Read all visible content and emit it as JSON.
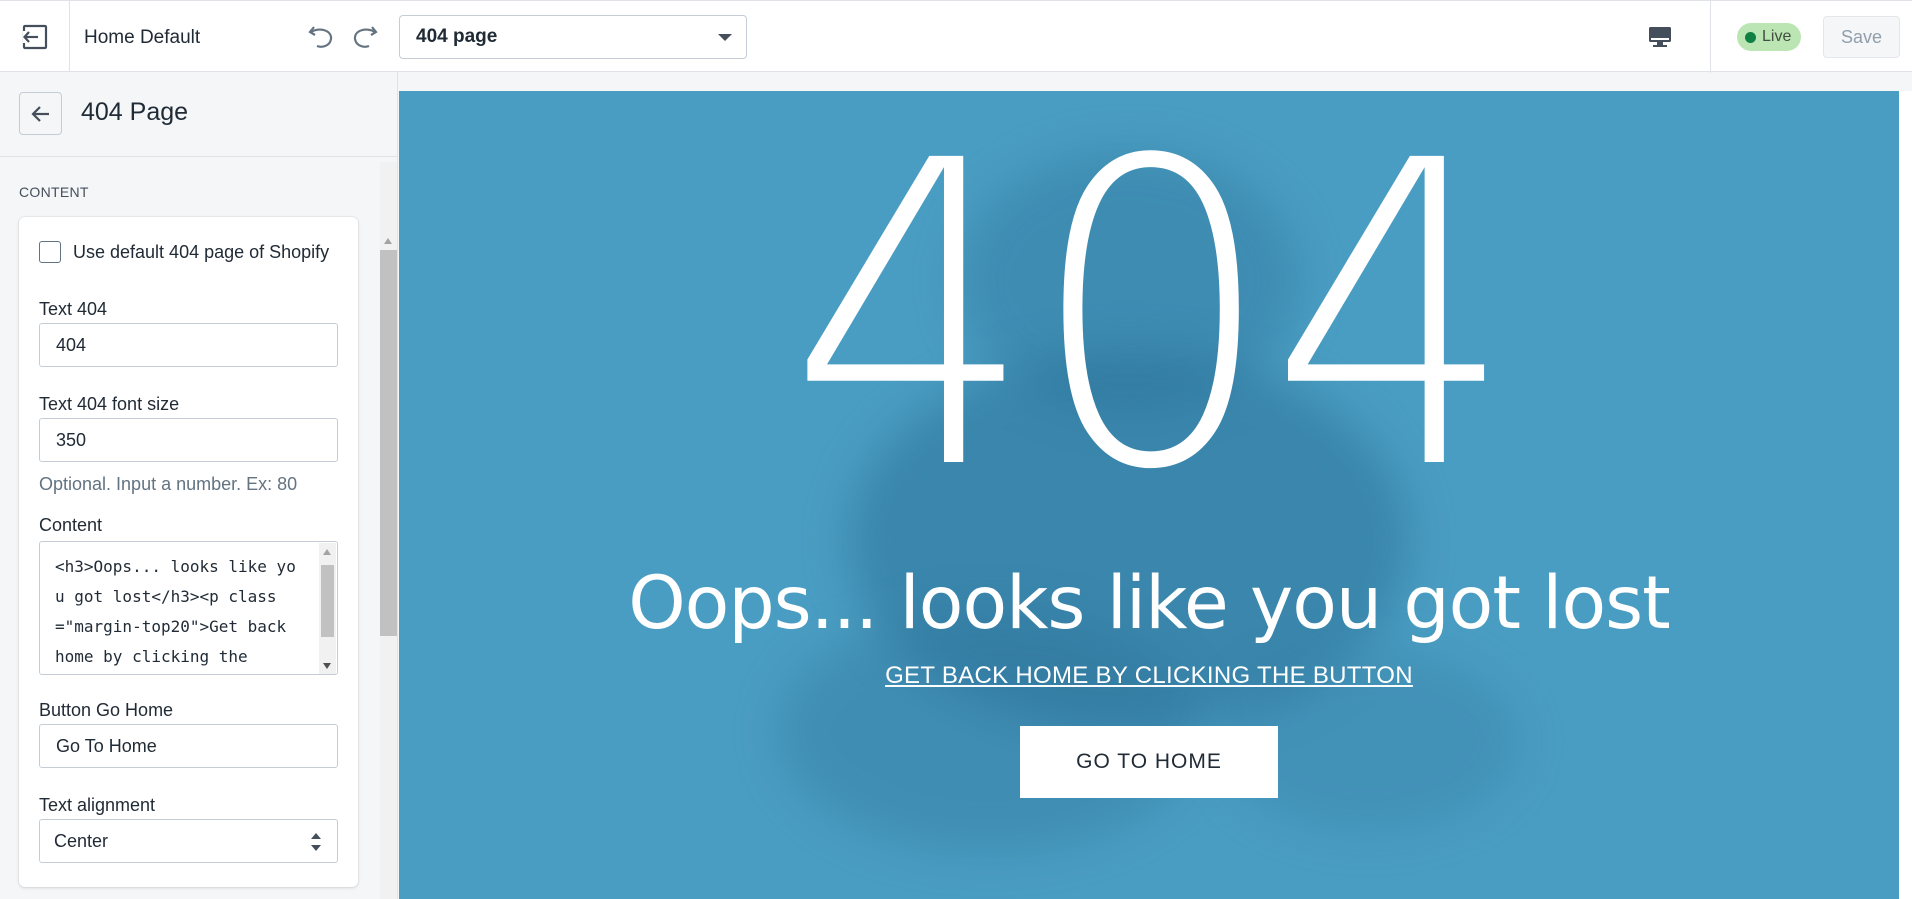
{
  "topbar": {
    "theme_name": "Home Default",
    "page_select_value": "404 page",
    "live_label": "Live",
    "save_label": "Save"
  },
  "sidebar": {
    "title": "404 Page",
    "section_label": "CONTENT",
    "use_default_label": "Use default 404 page of Shopify",
    "use_default_checked": false,
    "text404_label": "Text 404",
    "text404_value": "404",
    "fontsize_label": "Text 404 font size",
    "fontsize_value": "350",
    "fontsize_help": "Optional. Input a number. Ex: 80",
    "content_label": "Content",
    "content_value": "<h3>Oops... looks like you got lost</h3><p class=\"margin-top20\">Get back home by clicking the",
    "button_label": "Button Go Home",
    "button_value": "Go To Home",
    "alignment_label": "Text alignment",
    "alignment_value": "Center"
  },
  "preview": {
    "big_text": "404",
    "headline": "Oops... looks like you got lost",
    "link_text": "GET BACK HOME BY CLICKING THE BUTTON",
    "button_text": "GO TO HOME",
    "background_color": "#4a9dc2"
  },
  "colors": {
    "live_badge_bg": "#bbe5b3",
    "live_dot": "#108043",
    "preview_bg": "#4a9dc2"
  }
}
